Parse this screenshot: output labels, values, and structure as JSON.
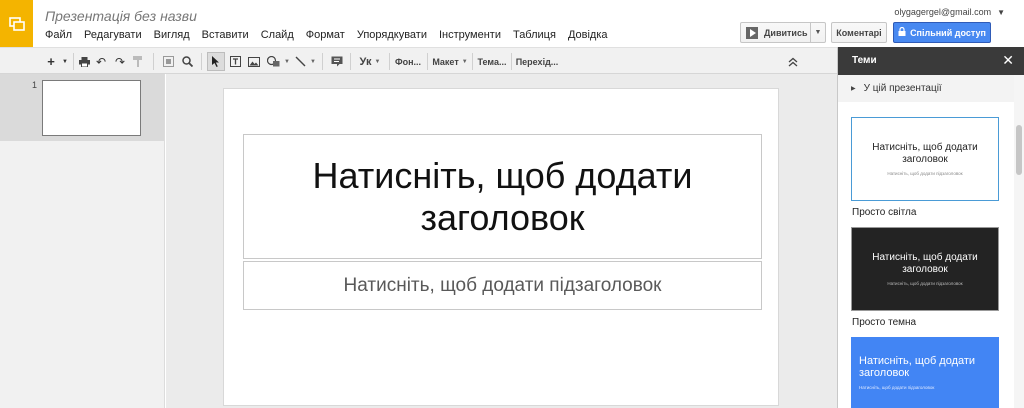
{
  "header": {
    "doc_title": "Презентація без назви",
    "account_email": "olygagergel@gmail.com",
    "menu": [
      "Файл",
      "Редагувати",
      "Вигляд",
      "Вставити",
      "Слайд",
      "Формат",
      "Упорядкувати",
      "Інструменти",
      "Таблиця",
      "Довідка"
    ],
    "present_label": "Дивитись",
    "comments_label": "Коментарі",
    "share_label": "Спільний доступ"
  },
  "toolbar": {
    "new_label": "+",
    "lang_label": "Ук",
    "background_label": "Фон...",
    "layout_label": "Макет",
    "theme_label": "Тема...",
    "transition_label": "Перехід..."
  },
  "filmstrip": {
    "slide_number": "1"
  },
  "slide": {
    "title_placeholder": "Натисніть, щоб додати заголовок",
    "subtitle_placeholder": "Натисніть, щоб додати підзаголовок"
  },
  "themes_panel": {
    "title": "Теми",
    "close": "✕",
    "section": "У цій презентації",
    "themes": [
      {
        "name": "Просто світла",
        "preview_title": "Натисніть, щоб додати заголовок",
        "preview_subtitle": "Натисніть, щоб додати підзаголовок"
      },
      {
        "name": "Просто темна",
        "preview_title": "Натисніть, щоб додати заголовок",
        "preview_subtitle": "Натисніть, щоб додати підзаголовок"
      },
      {
        "name": "",
        "preview_title": "Натисніть, щоб додати заголовок",
        "preview_subtitle": "Натисніть, щоб додати підзаголовок"
      }
    ]
  },
  "colors": {
    "brand_yellow": "#f4b400",
    "share_blue": "#4889f1",
    "themes_header": "#3a3a3a",
    "light_theme_border": "#4a9bd6",
    "dark_theme_bg": "#232323",
    "blue_theme_bg": "#4285f4"
  }
}
